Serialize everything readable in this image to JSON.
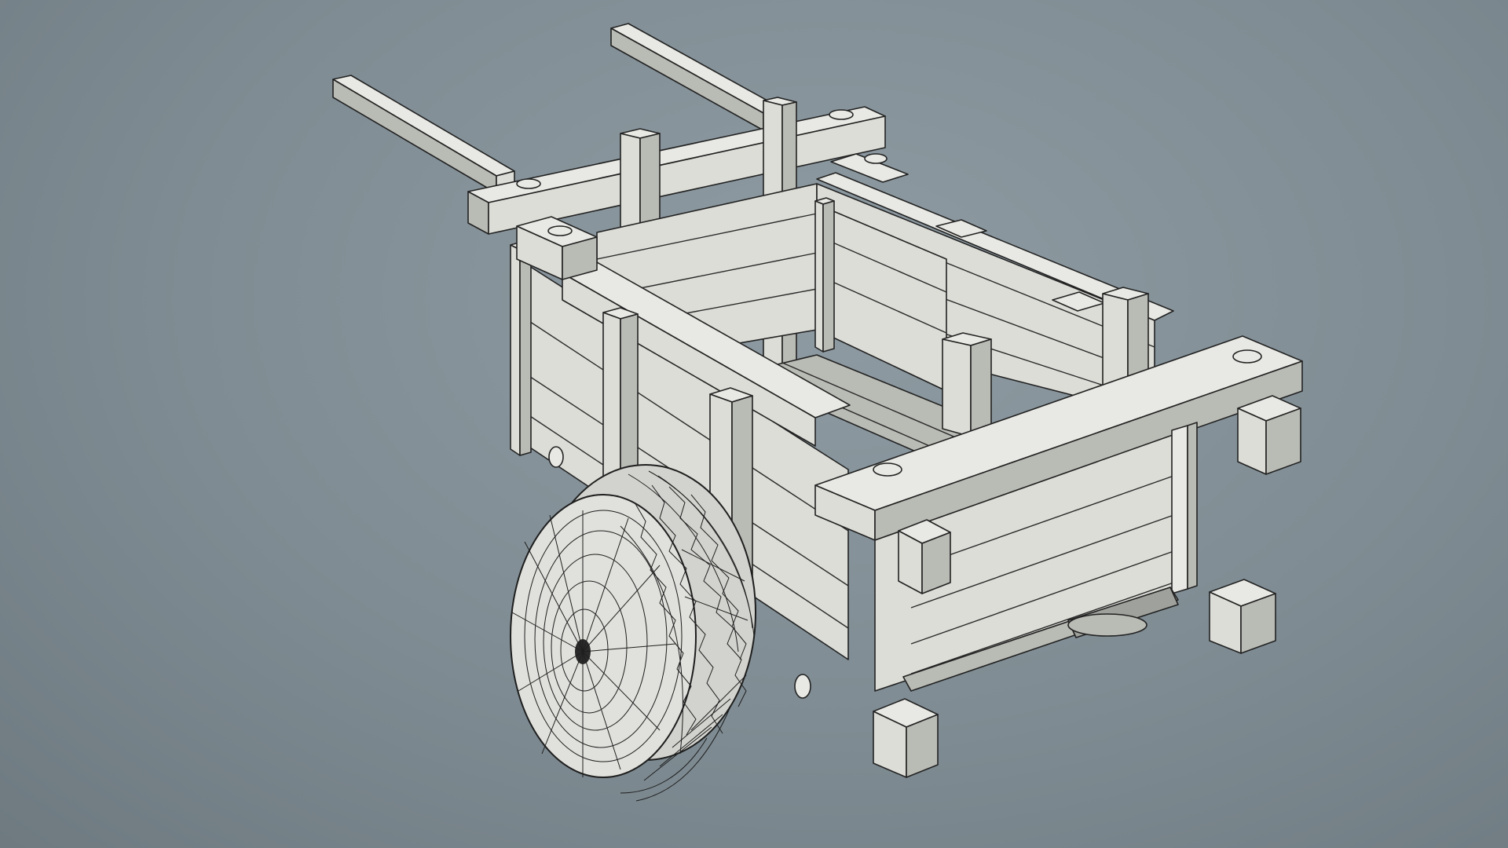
{
  "scene": {
    "subject": "wooden-cart-3d-wireframe",
    "colors": {
      "background": "#7f8c93",
      "wood": "#dcddd7",
      "wood_shadow": "#b9bbb5",
      "wireframe": "#222222",
      "tire": "#d2d3ce"
    }
  }
}
